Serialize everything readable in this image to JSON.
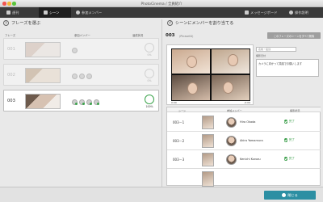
{
  "window": {
    "title": "PhotoCinema / 全員紹介"
  },
  "nav": {
    "home": "週刊",
    "scene": "シーン",
    "members": "参加メンバー",
    "message_board": "メッセージボード",
    "help": "操作説明"
  },
  "left_panel": {
    "step_num": "1",
    "step_title": "フレーズを選ぶ",
    "col_phrase": "フレーズ",
    "col_members": "参加メンバー",
    "col_rate": "達成状況",
    "phrases": [
      {
        "num": "001",
        "rate": "0%"
      },
      {
        "num": "002",
        "rate": "0%"
      },
      {
        "num": "003",
        "rate": "100%"
      }
    ]
  },
  "right_panel": {
    "step_num": "2",
    "step_title": "シーンにメンバーを割り当てる",
    "header_num": "003",
    "header_sub": "(Phrase04)",
    "scene_button": "このフレーズのシーンをすべて削除",
    "info_field": "名前・役割",
    "info_label": "撮影日付",
    "info_text": "カメラに向かって笑顔でお願いします",
    "video_left": "0:00",
    "video_right": "-0:09",
    "table": {
      "col_scene": "シーン",
      "col_member": "参加メンバー",
      "col_status": "撮影状況",
      "rows": [
        {
          "scene": "003－1",
          "name": "Hiro Okada",
          "status": "完了"
        },
        {
          "scene": "003－2",
          "name": "Akira Yamamura",
          "status": "完了"
        },
        {
          "scene": "003－3",
          "name": "Kenichi Kurozu",
          "status": "完了"
        }
      ]
    }
  },
  "footer": {
    "close_label": "閉じる"
  }
}
